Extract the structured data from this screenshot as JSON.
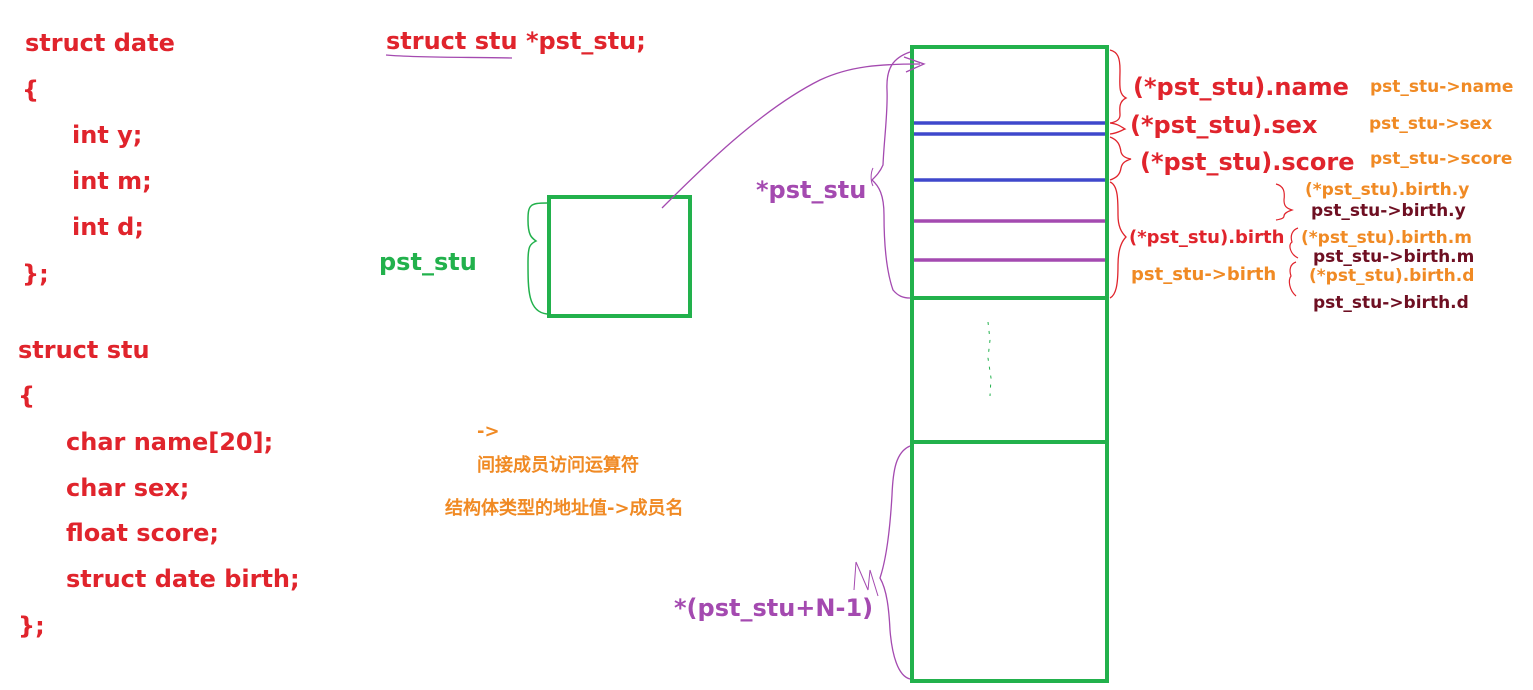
{
  "code": {
    "date_struct": [
      "struct date",
      "{",
      "int y;",
      "int m;",
      "int d;",
      "};"
    ],
    "stu_struct": [
      "struct stu",
      "{",
      "char name[20];",
      "char sex;",
      "float score;",
      "struct date birth;",
      "};"
    ]
  },
  "pointer_decl": {
    "type_text": "struct stu",
    "var_text": "*pst_stu;"
  },
  "labels": {
    "pointer_var": "pst_stu",
    "deref": "*pst_stu",
    "last_elem": "*(pst_stu+N-1)"
  },
  "members": {
    "name_dot": "(*pst_stu).name",
    "name_arrow": "pst_stu->name",
    "sex_dot": "(*pst_stu).sex",
    "sex_arrow": "pst_stu->sex",
    "score_dot": "(*pst_stu).score",
    "score_arrow": "pst_stu->score",
    "birth_dot": "(*pst_stu).birth",
    "birth_arrow": "pst_stu->birth",
    "birth_y_dot": "(*pst_stu).birth.y",
    "birth_y_arrow": "pst_stu->birth.y",
    "birth_m_dot": "(*pst_stu).birth.m",
    "birth_m_arrow": "pst_stu->birth.m",
    "birth_d_dot": "(*pst_stu).birth.d",
    "birth_d_arrow": "pst_stu->birth.d"
  },
  "notes": {
    "arrow_op": "->",
    "arrow_op_name": "间接成员访问运算符",
    "arrow_usage": "结构体类型的地址值->成员名"
  },
  "colors": {
    "red": "#e0242c",
    "orange": "#f08a24",
    "purple": "#a44ab0",
    "green": "#22b14c",
    "blue": "#3f48cc",
    "dark_red": "#6e0f22"
  }
}
